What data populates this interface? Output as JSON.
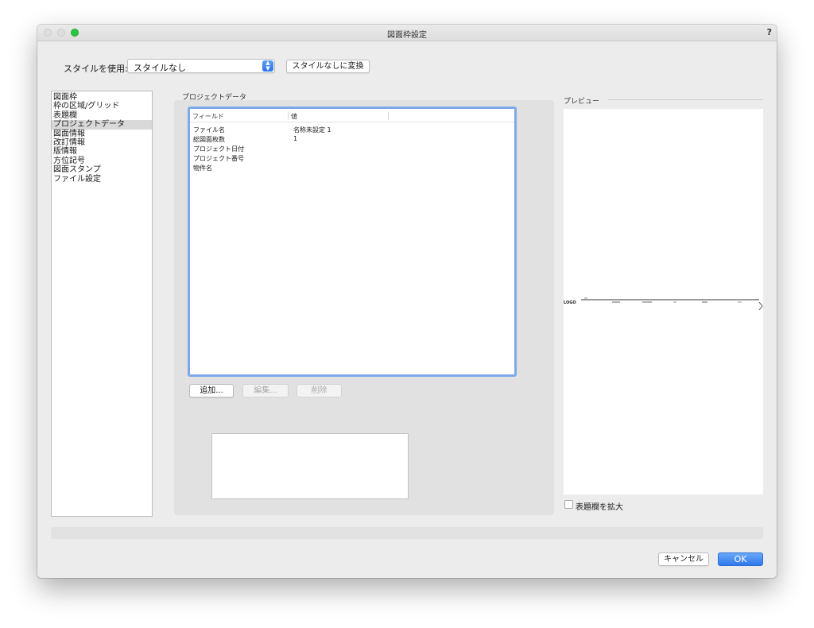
{
  "window": {
    "title": "図面枠設定",
    "help_label": "?"
  },
  "style": {
    "label": "スタイルを使用:",
    "selected": "スタイルなし",
    "convert_label": "スタイルなしに変換"
  },
  "sidebar": {
    "items": [
      {
        "label": "図面枠"
      },
      {
        "label": "枠の区域/グリッド"
      },
      {
        "label": "表題欄"
      },
      {
        "label": "プロジェクトデータ",
        "selected": true
      },
      {
        "label": "図面情報"
      },
      {
        "label": "改訂情報"
      },
      {
        "label": "版情報"
      },
      {
        "label": "方位記号"
      },
      {
        "label": "図面スタンプ"
      },
      {
        "label": "ファイル設定"
      }
    ]
  },
  "project": {
    "group_label": "プロジェクトデータ",
    "columns": {
      "field": "フィールド",
      "value": "値"
    },
    "rows": [
      {
        "field": "ファイル名",
        "value": "名称未設定 1"
      },
      {
        "field": "総図面枚数",
        "value": "1"
      },
      {
        "field": "プロジェクト日付",
        "value": ""
      },
      {
        "field": "プロジェクト番号",
        "value": ""
      },
      {
        "field": "物件名",
        "value": ""
      }
    ],
    "add_label": "追加...",
    "edit_label": "編集...",
    "delete_label": "削除"
  },
  "preview": {
    "label": "プレビュー",
    "logo_text": "LOGO",
    "expand_label": "表題欄を拡大",
    "expand_checked": false
  },
  "footer": {
    "cancel_label": "キャンセル",
    "ok_label": "OK"
  },
  "colors": {
    "accent": "#2f78ec",
    "focus_ring": "#7ea8ec",
    "selection": "#d9d9d9",
    "zoom_green": "#29c63f"
  }
}
